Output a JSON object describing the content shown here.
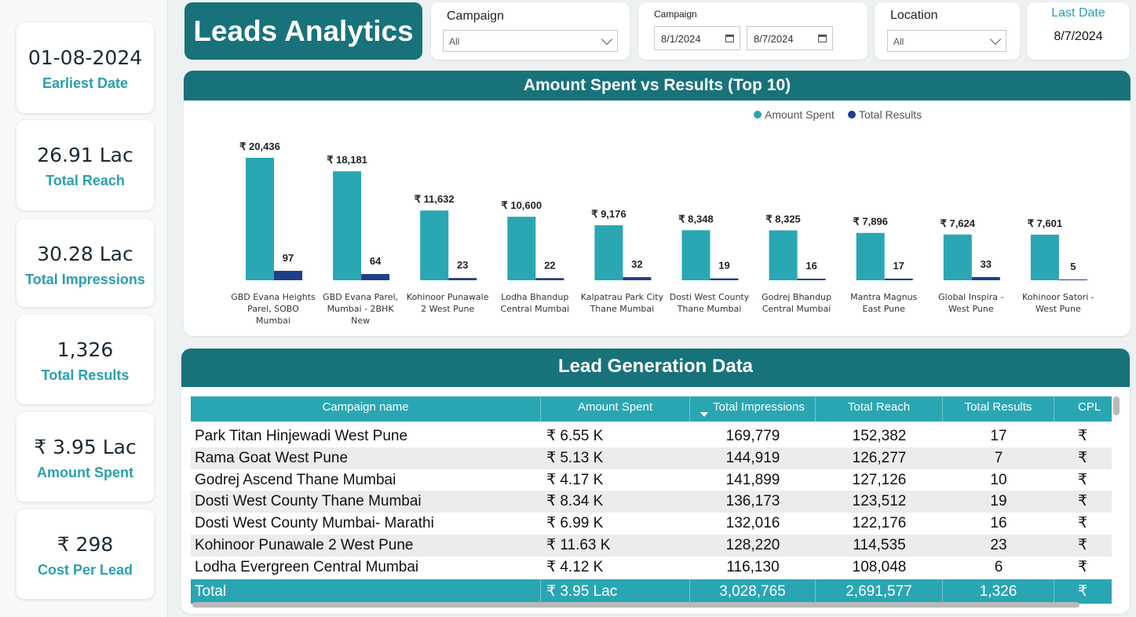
{
  "kpis": [
    {
      "value": "01-08-2024",
      "label": "Earliest Date"
    },
    {
      "value": "26.91 Lac",
      "label": "Total Reach"
    },
    {
      "value": "30.28 Lac",
      "label": "Total Impressions"
    },
    {
      "value": "1,326",
      "label": "Total Results"
    },
    {
      "value": "₹ 3.95 Lac",
      "label": "Amount Spent"
    },
    {
      "value": "₹ 298",
      "label": "Cost Per Lead"
    }
  ],
  "header": {
    "title": "Leads Analytics",
    "campaign_filter": {
      "label": "Campaign",
      "value": "All"
    },
    "date_filter": {
      "label": "Campaign",
      "start": "8/1/2024",
      "end": "8/7/2024"
    },
    "location_filter": {
      "label": "Location",
      "value": "All"
    },
    "last_date": {
      "label": "Last Date",
      "value": "8/7/2024"
    }
  },
  "colors": {
    "teal_dark": "#18727a",
    "teal": "#2aa6b3",
    "bar_spent": "#2aa6b3",
    "bar_results": "#1f3f8a"
  },
  "chart_data": {
    "type": "bar",
    "title": "Amount Spent vs Results (Top 10)",
    "legend_position": "top-center",
    "categories": [
      "GBD Evana Heights Parel, SOBO Mumbai",
      "GBD Evana Parel, Mumbai - 2BHK New",
      "Kohinoor Punawale 2 West Pune",
      "Lodha Bhandup Central Mumbai",
      "Kalpatrau Park City Thane Mumbai",
      "Dosti West County Thane Mumbai",
      "Godrej Bhandup Central Mumbai",
      "Mantra Magnus East Pune",
      "Global Inspira - West Pune",
      "Kohinoor Satori - West Pune"
    ],
    "category_lines": [
      [
        "GBD Evana Heights",
        "Parel, SOBO",
        "Mumbai"
      ],
      [
        "GBD Evana Parel,",
        "Mumbai - 2BHK",
        "New"
      ],
      [
        "Kohinoor Punawale",
        "2 West Pune"
      ],
      [
        "Lodha Bhandup",
        "Central Mumbai"
      ],
      [
        "Kalpatrau Park City",
        "Thane Mumbai"
      ],
      [
        "Dosti West County",
        "Thane Mumbai"
      ],
      [
        "Godrej Bhandup",
        "Central Mumbai"
      ],
      [
        "Mantra Magnus",
        "East Pune"
      ],
      [
        "Global Inspira -",
        "West Pune"
      ],
      [
        "Kohinoor Satori -",
        "West Pune"
      ]
    ],
    "series": [
      {
        "name": "Amount Spent",
        "values": [
          20436,
          18181,
          11632,
          10600,
          9176,
          8348,
          8325,
          7896,
          7624,
          7601
        ],
        "labels": [
          "₹ 20,436",
          "₹ 18,181",
          "₹ 11,632",
          "₹ 10,600",
          "₹ 9,176",
          "₹ 8,348",
          "₹ 8,325",
          "₹ 7,896",
          "₹ 7,624",
          "₹ 7,601"
        ]
      },
      {
        "name": "Total Results",
        "values": [
          97,
          64,
          23,
          22,
          32,
          19,
          16,
          17,
          33,
          5
        ],
        "labels": [
          "97",
          "64",
          "23",
          "22",
          "32",
          "19",
          "16",
          "17",
          "33",
          "5"
        ]
      }
    ]
  },
  "table": {
    "title": "Lead Generation Data",
    "columns": [
      "Campaign name",
      "Amount Spent",
      "Total Impressions",
      "Total Reach",
      "Total Results",
      "CPL"
    ],
    "rows": [
      [
        "Park Titan Hinjewadi West Pune",
        "₹ 6.55 K",
        "169,779",
        "152,382",
        "17",
        "₹"
      ],
      [
        "Rama Goat West Pune",
        "₹ 5.13 K",
        "144,919",
        "126,277",
        "7",
        "₹"
      ],
      [
        "Godrej Ascend Thane Mumbai",
        "₹ 4.17 K",
        "141,899",
        "127,126",
        "10",
        "₹"
      ],
      [
        "Dosti West County Thane Mumbai",
        "₹ 8.34 K",
        "136,173",
        "123,512",
        "19",
        "₹"
      ],
      [
        "Dosti West County Mumbai- Marathi",
        "₹ 6.99 K",
        "132,016",
        "122,176",
        "16",
        "₹"
      ],
      [
        "Kohinoor Punawale 2 West Pune",
        "₹ 11.63 K",
        "128,220",
        "114,535",
        "23",
        "₹"
      ],
      [
        "Lodha Evergreen Central Mumbai",
        "₹ 4.12 K",
        "116,130",
        "108,048",
        "6",
        "₹"
      ]
    ],
    "total": [
      "Total",
      "₹ 3.95 Lac",
      "3,028,765",
      "2,691,577",
      "1,326",
      "₹"
    ]
  }
}
